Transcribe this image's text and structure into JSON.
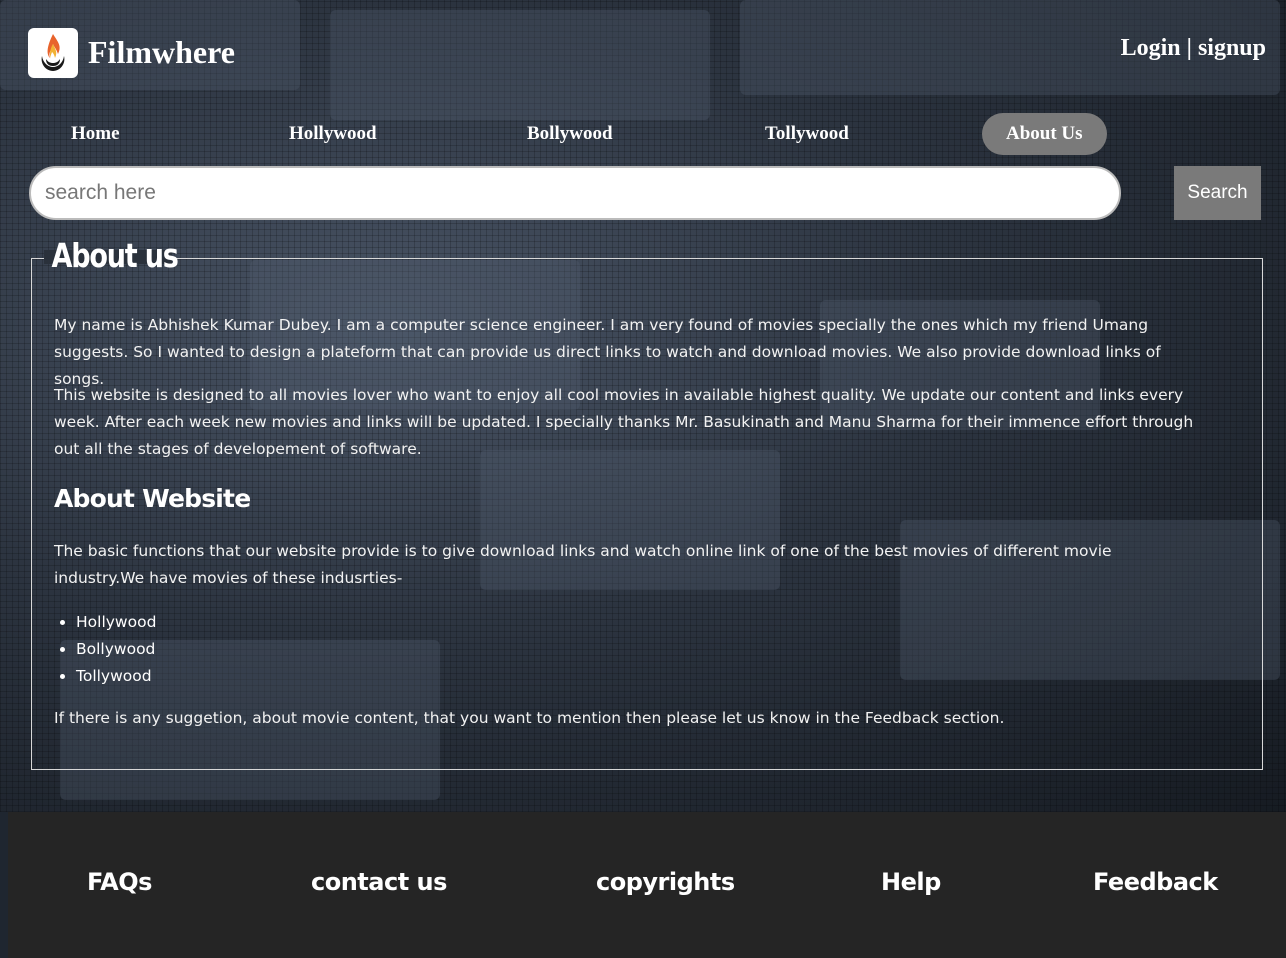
{
  "header": {
    "brand": "Filmwhere",
    "logo_icon": "flame-logo-icon",
    "login_label": "Login",
    "auth_separator": "|",
    "signup_label": "signup"
  },
  "nav": {
    "items": [
      {
        "label": "Home"
      },
      {
        "label": "Hollywood"
      },
      {
        "label": "Bollywood"
      },
      {
        "label": "Tollywood"
      },
      {
        "label": "About Us",
        "active": true
      }
    ]
  },
  "search": {
    "placeholder": "search here",
    "value": "",
    "button_label": "Search"
  },
  "about": {
    "title": "About us",
    "paragraph1": "My name is Abhishek Kumar Dubey. I am a computer science engineer. I am very found of movies specially the ones which my friend Umang suggests. So I wanted to design a plateform that can provide us direct links to watch and download movies. We also provide download links of songs.",
    "paragraph2": "This website is designed to all movies lover who want to enjoy all cool movies in available highest quality. We update our content and links every week. After each week new movies and links will be updated. I specially thanks Mr. Basukinath and Manu Sharma for their immence effort through out all the stages of developement of software.",
    "website_heading": "About Website",
    "paragraph3": "The basic functions that our website provide is to give download links and watch online link of one of the best movies of different movie industry.We have movies of these indusrties-",
    "industries": [
      "Hollywood",
      "Bollywood",
      "Tollywood"
    ],
    "paragraph4": "If there is any suggetion, about movie content, that you want to mention then please let us know in the Feedback section."
  },
  "footer": {
    "links": [
      "FAQs",
      "contact us",
      "copyrights",
      "Help",
      "Feedback"
    ]
  },
  "colors": {
    "active_nav": "#7a7a7a",
    "footer_bg": "#252525",
    "search_button": "#7a7a7a"
  }
}
